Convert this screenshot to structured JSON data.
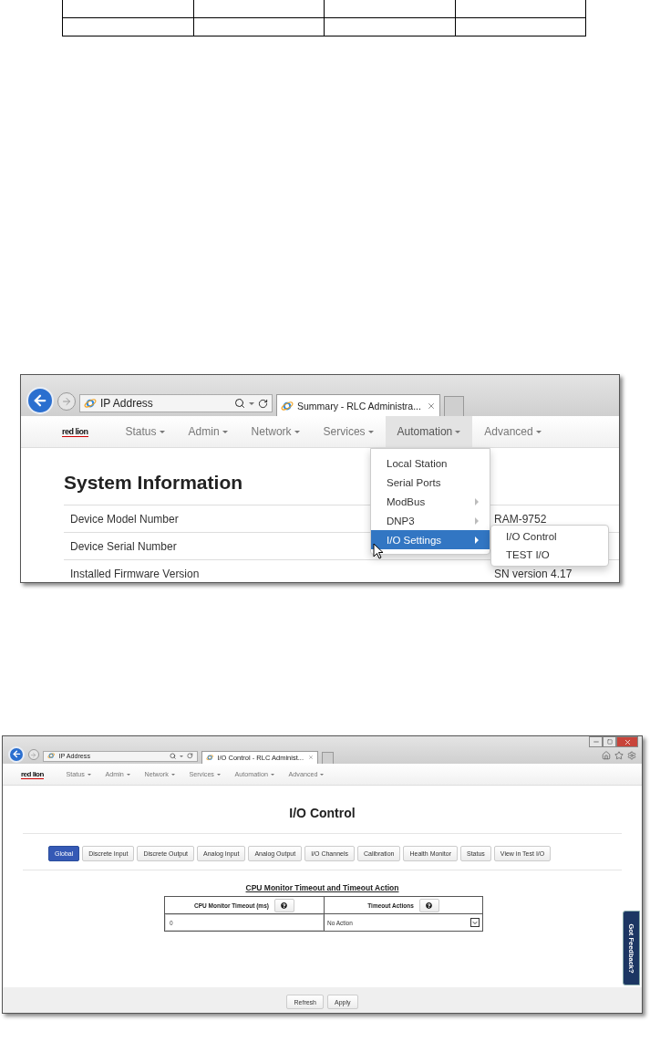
{
  "menu_screenshot": {
    "browser": {
      "address": "IP Address",
      "tab_title": "Summary - RLC Administra..."
    },
    "logo": "red lion",
    "nav": [
      {
        "label": "Status",
        "selected": false
      },
      {
        "label": "Admin",
        "selected": false
      },
      {
        "label": "Network",
        "selected": false
      },
      {
        "label": "Services",
        "selected": false
      },
      {
        "label": "Automation",
        "selected": true
      },
      {
        "label": "Advanced",
        "selected": false
      }
    ],
    "heading": "System Information",
    "rows": [
      {
        "label": "Device Model Number",
        "value": "RAM-9752"
      },
      {
        "label": "Device Serial Number"
      },
      {
        "label": "Installed Firmware Version",
        "value": "SN version 4.17"
      }
    ],
    "menu": [
      {
        "label": "Local Station",
        "has_submenu": false,
        "selected": false
      },
      {
        "label": "Serial Ports",
        "has_submenu": false,
        "selected": false
      },
      {
        "label": "ModBus",
        "has_submenu": true,
        "selected": false
      },
      {
        "label": "DNP3",
        "has_submenu": true,
        "selected": false
      },
      {
        "label": "I/O Settings",
        "has_submenu": true,
        "selected": true
      }
    ],
    "submenu": [
      {
        "label": "I/O Control"
      },
      {
        "label": "TEST I/O"
      }
    ]
  },
  "page_screenshot": {
    "browser": {
      "address": "IP Address",
      "tab_title": "I/O Control - RLC Administ..."
    },
    "logo": "red lion",
    "nav": [
      {
        "label": "Status",
        "selected": false
      },
      {
        "label": "Admin",
        "selected": false
      },
      {
        "label": "Network",
        "selected": false
      },
      {
        "label": "Services",
        "selected": false
      },
      {
        "label": "Automation",
        "selected": false
      },
      {
        "label": "Advanced",
        "selected": false
      }
    ],
    "title": "I/O Control",
    "tabs": [
      {
        "label": "Global",
        "selected": true
      },
      {
        "label": "Discrete Input",
        "selected": false
      },
      {
        "label": "Discrete Output",
        "selected": false
      },
      {
        "label": "Analog Input",
        "selected": false
      },
      {
        "label": "Analog Output",
        "selected": false
      },
      {
        "label": "I/O Channels",
        "selected": false
      },
      {
        "label": "Calibration",
        "selected": false
      },
      {
        "label": "Health Monitor",
        "selected": false
      },
      {
        "label": "Status",
        "selected": false
      },
      {
        "label": "View in Test I/O",
        "selected": false
      }
    ],
    "section_title": "CPU Monitor Timeout and Timeout Action",
    "table": {
      "columns": [
        "CPU Monitor Timeout (ms)",
        "Timeout Actions"
      ],
      "timeout_value": "0",
      "action_value": "No Action"
    },
    "feedback_tab": "Got Feedback?",
    "buttons": [
      "Refresh",
      "Apply"
    ]
  }
}
